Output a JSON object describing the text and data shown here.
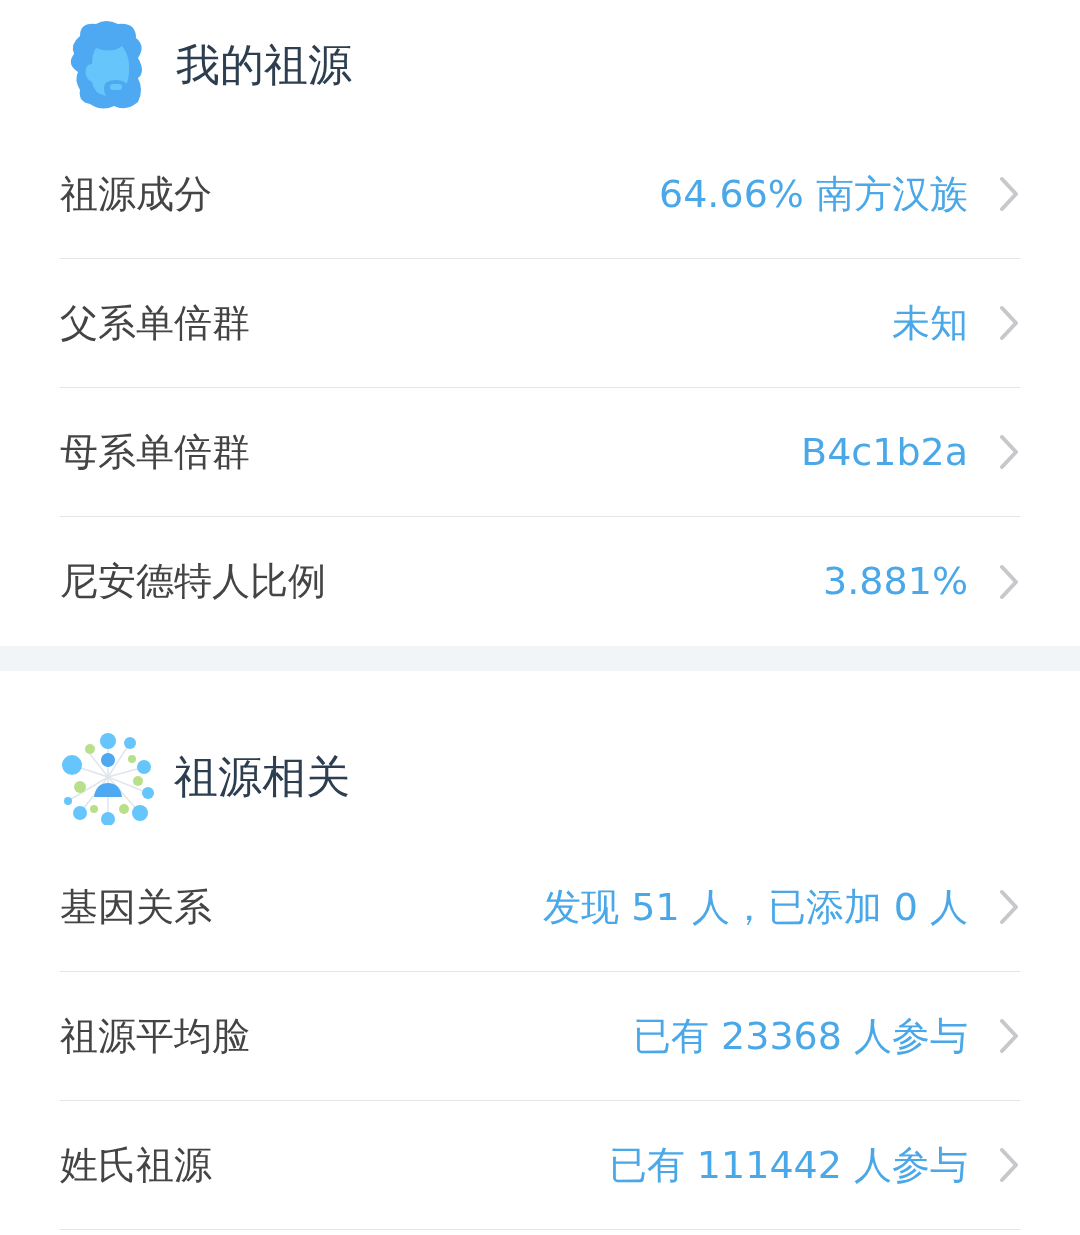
{
  "sections": [
    {
      "kind": "profile",
      "title": "我的祖源",
      "rows": [
        {
          "label": "祖源成分",
          "value": "64.66% 南方汉族"
        },
        {
          "label": "父系单倍群",
          "value": "未知"
        },
        {
          "label": "母系单倍群",
          "value": "B4c1b2a"
        },
        {
          "label": "尼安德特人比例",
          "value": "3.881%"
        }
      ]
    },
    {
      "kind": "network",
      "title": "祖源相关",
      "rows": [
        {
          "label": "基因关系",
          "value": "发现 51 人，已添加 0 人"
        },
        {
          "label": "祖源平均脸",
          "value": "已有 23368 人参与"
        },
        {
          "label": "姓氏祖源",
          "value": "已有 111442 人参与"
        }
      ]
    }
  ]
}
